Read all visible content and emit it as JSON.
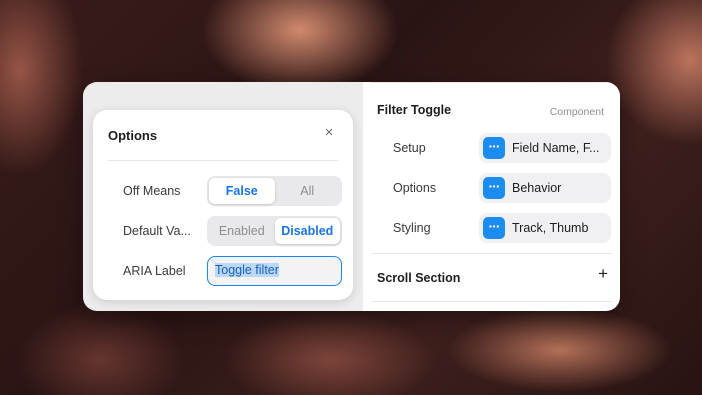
{
  "options_popover": {
    "title": "Options",
    "close_glyph": "×",
    "off_means": {
      "label": "Off Means",
      "options": [
        "False",
        "All"
      ],
      "selected": "False"
    },
    "default_value": {
      "label": "Default Va...",
      "options": [
        "Enabled",
        "Disabled"
      ],
      "selected": "Disabled"
    },
    "aria_label": {
      "label": "ARIA Label",
      "value": "Toggle filter"
    }
  },
  "inspector": {
    "component_name": "Filter Toggle",
    "component_tag": "Component",
    "properties": [
      {
        "label": "Setup",
        "value": "Field Name, F...",
        "icon": "ellipsis-icon"
      },
      {
        "label": "Options",
        "value": "Behavior",
        "icon": "ellipsis-icon"
      },
      {
        "label": "Styling",
        "value": "Track, Thumb",
        "icon": "ellipsis-icon"
      }
    ],
    "chip_icon_glyph": "···",
    "scroll_section": {
      "title": "Scroll Section",
      "add_glyph": "+"
    }
  },
  "colors": {
    "accent": "#1a8cf0",
    "selected_text": "#1a73e8"
  }
}
